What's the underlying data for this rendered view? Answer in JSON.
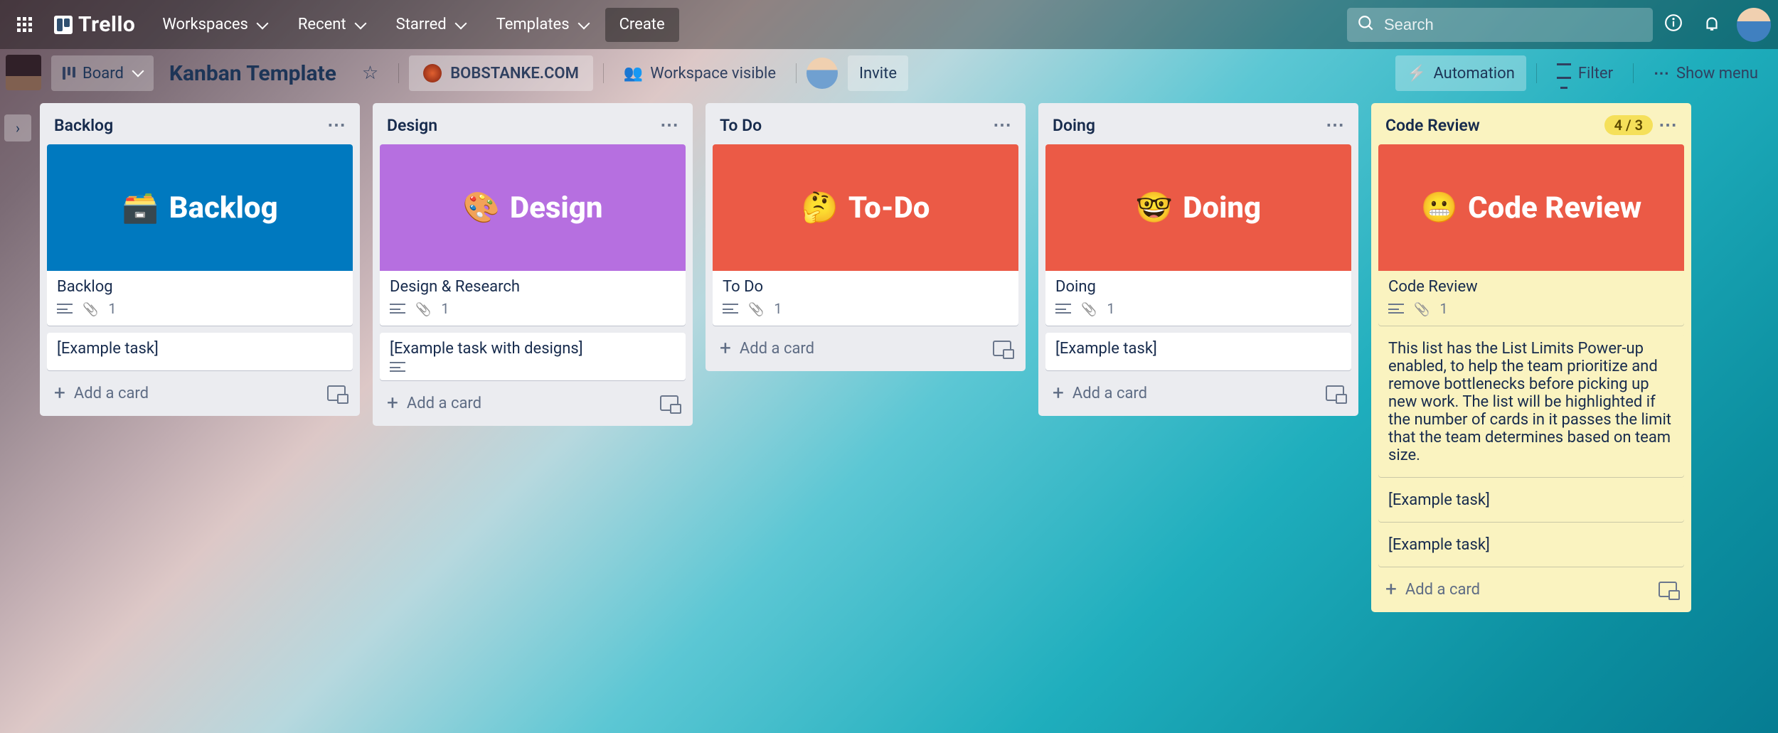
{
  "top": {
    "brand": "Trello",
    "nav": [
      "Workspaces",
      "Recent",
      "Starred",
      "Templates"
    ],
    "create": "Create",
    "search_placeholder": "Search"
  },
  "board": {
    "view_label": "Board",
    "title": "Kanban Template",
    "site_link": "BOBSTANKE.COM",
    "visibility": "Workspace visible",
    "invite": "Invite",
    "automation": "Automation",
    "filter": "Filter",
    "show_menu": "Show menu"
  },
  "lists": [
    {
      "title": "Backlog",
      "cards": [
        {
          "title": "Backlog",
          "cover_color": "#0079bf",
          "cover_emoji": "🗃️",
          "cover_text": "Backlog",
          "has_desc": true,
          "attachments": 1
        },
        {
          "title": "[Example task]"
        }
      ],
      "add": "Add a card"
    },
    {
      "title": "Design",
      "cards": [
        {
          "title": "Design & Research",
          "cover_color": "#b66fe0",
          "cover_emoji": "🎨",
          "cover_text": "Design",
          "has_desc": true,
          "attachments": 1
        },
        {
          "title": "[Example task with designs]",
          "has_desc": true
        }
      ],
      "add": "Add a card"
    },
    {
      "title": "To Do",
      "cards": [
        {
          "title": "To Do",
          "cover_color": "#eb5a46",
          "cover_emoji": "🤔",
          "cover_text": "To-Do",
          "has_desc": true,
          "attachments": 1
        }
      ],
      "add": "Add a card"
    },
    {
      "title": "Doing",
      "cards": [
        {
          "title": "Doing",
          "cover_color": "#eb5a46",
          "cover_emoji": "🤓",
          "cover_text": "Doing",
          "has_desc": true,
          "attachments": 1
        },
        {
          "title": "[Example task]"
        }
      ],
      "add": "Add a card"
    },
    {
      "title": "Code Review",
      "limit": "4 / 3",
      "over_limit": true,
      "cards": [
        {
          "title": "Code Review",
          "cover_color": "#eb5a46",
          "cover_emoji": "😬",
          "cover_text": "Code Review",
          "has_desc": true,
          "attachments": 1
        },
        {
          "title": "This list has the List Limits Power-up enabled, to help the team prioritize and remove bottlenecks before picking up new work. The list will be highlighted if the number of cards in it passes the limit that the team determines based on team size."
        },
        {
          "title": "[Example task]"
        },
        {
          "title": "[Example task]"
        }
      ],
      "add": "Add a card"
    }
  ]
}
